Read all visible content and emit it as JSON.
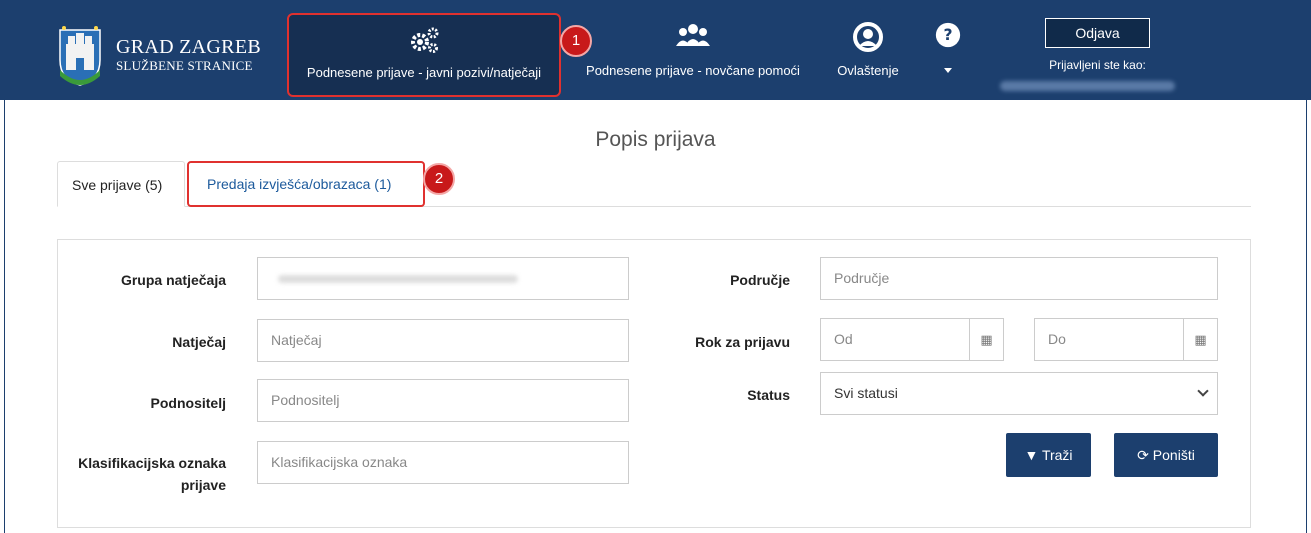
{
  "header": {
    "brand_title": "GRAD ZAGREB",
    "brand_subtitle": "SLUŽBENE STRANICE",
    "nav": [
      {
        "label": "Podnesene prijave - javni pozivi/natječaji",
        "icon": "gears-icon"
      },
      {
        "label": "Podnesene prijave - novčane pomoći",
        "icon": "users-icon"
      },
      {
        "label": "Ovlaštenje",
        "icon": "user-circle-icon"
      },
      {
        "label": "",
        "icon": "help-icon"
      }
    ],
    "logout_label": "Odjava",
    "logged_in_label": "Prijavljeni ste kao:",
    "accent": "#1c3f6e"
  },
  "annotations": {
    "badge_1": "1",
    "badge_2": "2",
    "color": "#e0312f"
  },
  "page_title": "Popis prijava",
  "tabs": [
    {
      "label": "Sve prijave (5)",
      "active": true
    },
    {
      "label": "Predaja izvješća/obrazaca (1)",
      "active": false
    }
  ],
  "form": {
    "group_label": "Grupa natječaja",
    "competition_label": "Natječaj",
    "competition_placeholder": "Natječaj",
    "applicant_label": "Podnositelj",
    "applicant_placeholder": "Podnositelj",
    "classification_label_1": "Klasifikacijska oznaka",
    "classification_label_2": "prijave",
    "classification_placeholder": "Klasifikacijska oznaka",
    "area_label": "Područje",
    "area_placeholder": "Područje",
    "deadline_label": "Rok za prijavu",
    "from_placeholder": "Od",
    "to_placeholder": "Do",
    "status_label": "Status",
    "status_value": "Svi statusi",
    "search_button": "Traži",
    "reset_button": "Poništi"
  }
}
